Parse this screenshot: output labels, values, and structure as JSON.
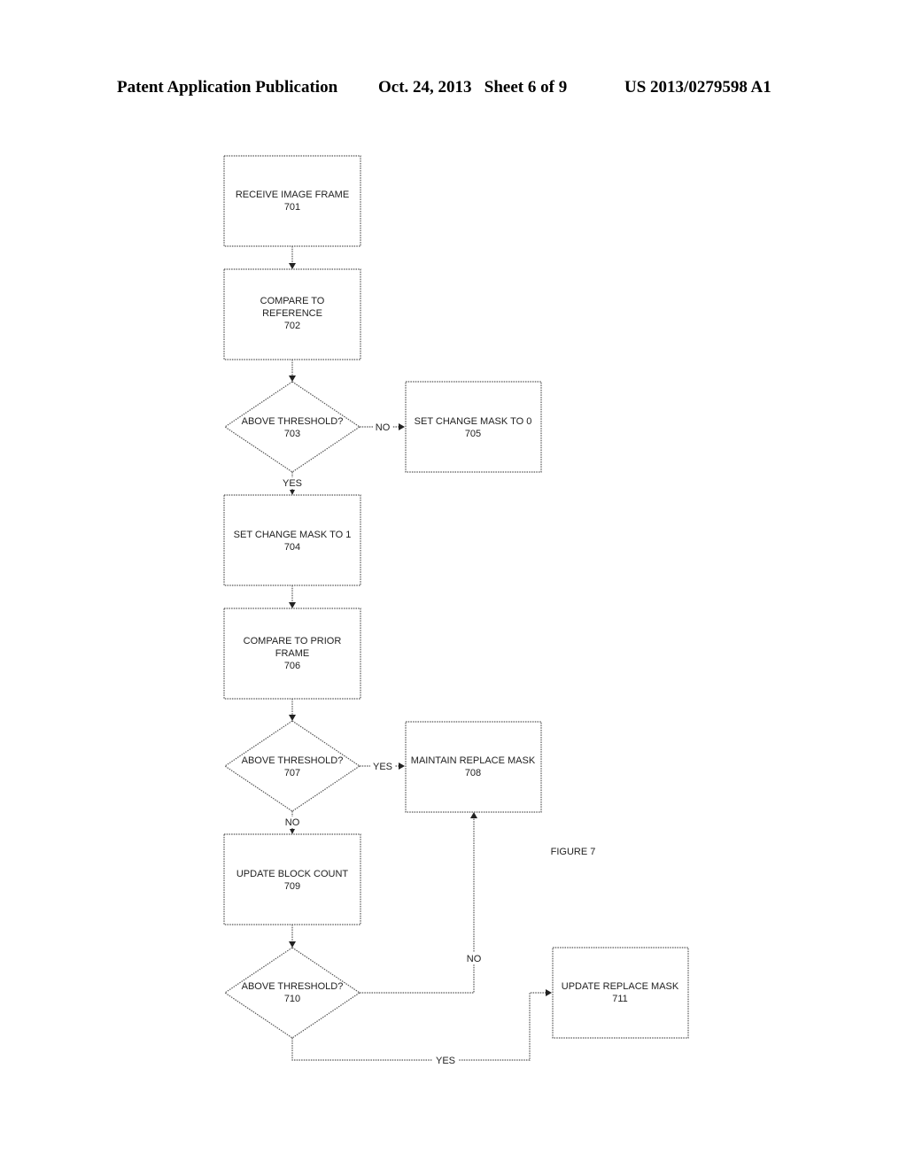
{
  "header": {
    "left": "Patent Application Publication",
    "middle": "Oct. 24, 2013   Sheet 6 of 9",
    "right": "US 2013/0279598 A1"
  },
  "figure_label": "FIGURE 7",
  "nodes": {
    "n701": {
      "type": "process",
      "lines": [
        "RECEIVE IMAGE FRAME",
        "701"
      ]
    },
    "n702": {
      "type": "process",
      "lines": [
        "COMPARE TO",
        "REFERENCE",
        "702"
      ]
    },
    "n703": {
      "type": "decision",
      "lines": [
        "ABOVE THRESHOLD?",
        "703"
      ]
    },
    "n704": {
      "type": "process",
      "lines": [
        "SET CHANGE MASK TO 1",
        "704"
      ]
    },
    "n705": {
      "type": "process",
      "lines": [
        "SET CHANGE MASK TO 0",
        "705"
      ]
    },
    "n706": {
      "type": "process",
      "lines": [
        "COMPARE TO PRIOR",
        "FRAME",
        "706"
      ]
    },
    "n707": {
      "type": "decision",
      "lines": [
        "ABOVE THRESHOLD?",
        "707"
      ]
    },
    "n708": {
      "type": "process",
      "lines": [
        "MAINTAIN REPLACE MASK",
        "708"
      ]
    },
    "n709": {
      "type": "process",
      "lines": [
        "UPDATE BLOCK COUNT",
        "709"
      ]
    },
    "n710": {
      "type": "decision",
      "lines": [
        "ABOVE THRESHOLD?",
        "710"
      ]
    },
    "n711": {
      "type": "process",
      "lines": [
        "UPDATE REPLACE MASK",
        "711"
      ]
    }
  },
  "edges": [
    {
      "from": "701",
      "to": "702",
      "label": ""
    },
    {
      "from": "702",
      "to": "703",
      "label": ""
    },
    {
      "from": "703",
      "to": "705",
      "label": "NO"
    },
    {
      "from": "703",
      "to": "704",
      "label": "YES"
    },
    {
      "from": "704",
      "to": "706",
      "label": ""
    },
    {
      "from": "706",
      "to": "707",
      "label": ""
    },
    {
      "from": "707",
      "to": "708",
      "label": "YES"
    },
    {
      "from": "707",
      "to": "709",
      "label": "NO"
    },
    {
      "from": "709",
      "to": "710",
      "label": ""
    },
    {
      "from": "710",
      "to": "708",
      "label": "NO"
    },
    {
      "from": "710",
      "to": "711",
      "label": "YES"
    }
  ],
  "edge_labels": {
    "e703_705": "NO",
    "e703_704": "YES",
    "e707_708": "YES",
    "e707_709": "NO",
    "e710_708": "NO",
    "e710_711": "YES"
  }
}
